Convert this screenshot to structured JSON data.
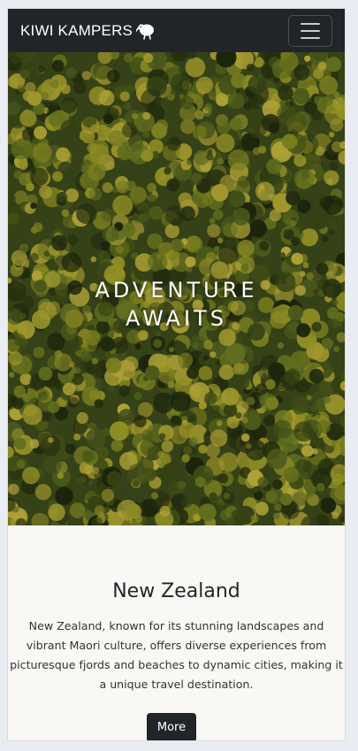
{
  "navbar": {
    "brand": "KIWI KAMPERS",
    "brand_icon": "kiwi-bird-icon",
    "menu_icon": "hamburger-menu-icon"
  },
  "hero": {
    "title_line1": "ADVENTURE",
    "title_line2": "AWAITS",
    "image": "aerial-forest-canopy"
  },
  "section": {
    "heading": "New Zealand",
    "body": "New Zealand, known for its stunning landscapes and vibrant Maori culture, offers diverse experiences from picturesque fjords and beaches to dynamic cities, making it a unique travel destination.",
    "button_label": "More"
  },
  "colors": {
    "navbar_bg": "#212529",
    "page_bg": "#faf8f5",
    "button_bg": "#212529",
    "text": "#212529"
  }
}
